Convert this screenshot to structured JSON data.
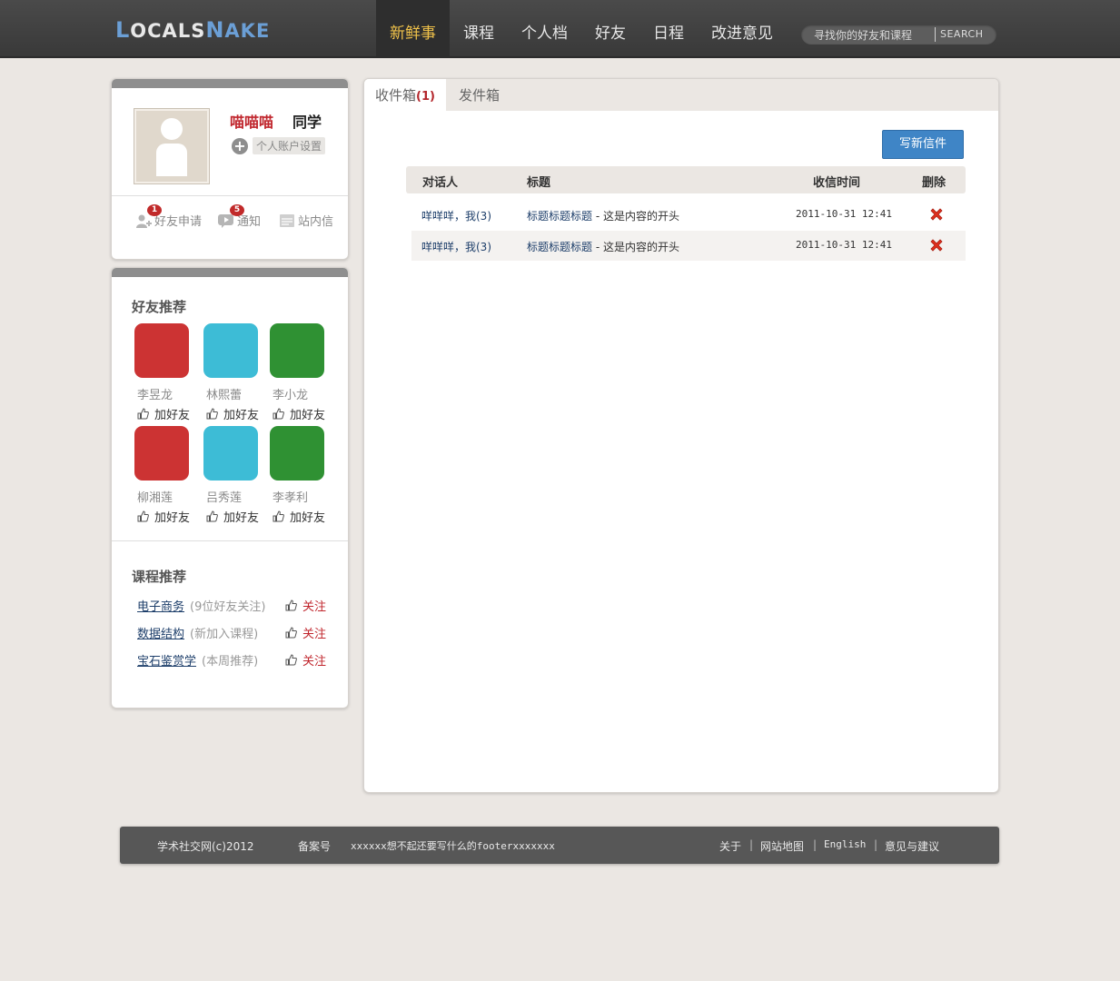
{
  "header": {
    "logo": {
      "p1": "L",
      "p2": "OCALS",
      "p3": "N",
      "p4": "AKE"
    },
    "nav": [
      "新鲜事",
      "课程",
      "个人档",
      "好友",
      "日程",
      "改进意见"
    ],
    "search_placeholder": "寻找你的好友和课程",
    "search_button": "SEARCH"
  },
  "profile": {
    "name": "喵喵喵",
    "suffix": "同学",
    "settings_label": "个人账户设置",
    "quick": [
      {
        "label": "好友申请",
        "badge": "1"
      },
      {
        "label": "通知",
        "badge": "5"
      },
      {
        "label": "站内信",
        "badge": ""
      }
    ]
  },
  "recommend": {
    "friends_title": "好友推荐",
    "add_label": "加好友",
    "friends": [
      {
        "name": "李昱龙",
        "color": "#cc3333"
      },
      {
        "name": "林熙蕾",
        "color": "#3dbcd6"
      },
      {
        "name": "李小龙",
        "color": "#2f9133"
      },
      {
        "name": "柳湘莲",
        "color": "#cc3333"
      },
      {
        "name": "吕秀莲",
        "color": "#3dbcd6"
      },
      {
        "name": "李孝利",
        "color": "#2f9133"
      }
    ],
    "courses_title": "课程推荐",
    "follow_label": "关注",
    "courses": [
      {
        "name": "电子商务",
        "note": "(9位好友关注)"
      },
      {
        "name": "数据结构",
        "note": "(新加入课程)"
      },
      {
        "name": "宝石鉴赏学",
        "note": "(本周推荐)"
      }
    ]
  },
  "mail": {
    "tabs": [
      {
        "label": "收件箱",
        "count": "(1)"
      },
      {
        "label": "发件箱",
        "count": ""
      }
    ],
    "write_button": "写新信件",
    "columns": [
      "对话人",
      "标题",
      "收信时间",
      "删除"
    ],
    "rows": [
      {
        "peer": "咩咩咩，我(3)",
        "title": "标题标题标题",
        "preview": "这是内容的开头",
        "time": "2011-10-31 12:41"
      },
      {
        "peer": "咩咩咩，我(3)",
        "title": "标题标题标题",
        "preview": "这是内容的开头",
        "time": "2011-10-31 12:41"
      }
    ]
  },
  "footer": {
    "copyright": "学术社交网(c)2012",
    "beian": "备案号",
    "text": "xxxxxx想不起还要写什么的footerxxxxxxx",
    "links": [
      "关于",
      "网站地图",
      "English",
      "意见与建议"
    ]
  }
}
